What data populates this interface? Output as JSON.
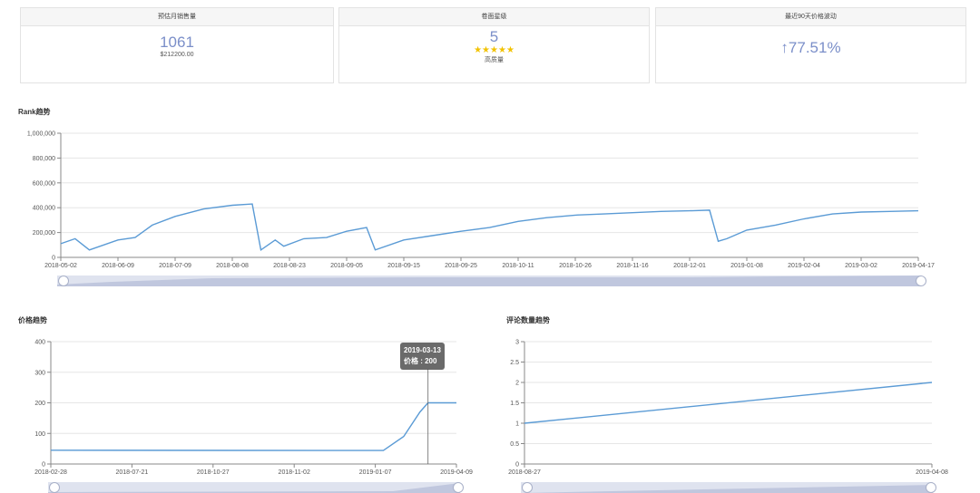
{
  "cards": [
    {
      "head": "预估月销售量",
      "value": "1061",
      "sub": "$212200.00"
    },
    {
      "head": "卷面星级",
      "value": "5",
      "stars": "★★★★★",
      "sub": "高质量"
    },
    {
      "head": "最近90天价格波动",
      "value": "↑77.51%"
    }
  ],
  "sections": {
    "rank": "Rank趋势",
    "price": "价格趋势",
    "reviews": "评论数量趋势"
  },
  "tooltip": {
    "date": "2019-03-13",
    "label": "价格 : 200"
  },
  "colors": {
    "line": "#5b9bd5",
    "accent": "#7b8fc9",
    "star": "#f2c200"
  },
  "chart_data": [
    {
      "type": "line",
      "title": "Rank趋势",
      "ylim": [
        0,
        1000000
      ],
      "y_ticks": [
        "0",
        "200,000",
        "400,000",
        "600,000",
        "800,000",
        "1,000,000"
      ],
      "x_ticks": [
        "2018-05-02",
        "2018-06-09",
        "2018-07-09",
        "2018-08-08",
        "2018-08-23",
        "2018-09-05",
        "2018-09-15",
        "2018-09-25",
        "2018-10-11",
        "2018-10-26",
        "2018-11-16",
        "2018-12-01",
        "2019-01-08",
        "2019-02-04",
        "2019-03-02",
        "2019-04-17"
      ],
      "points": [
        [
          0,
          110000
        ],
        [
          0.5,
          150000
        ],
        [
          1,
          60000
        ],
        [
          2,
          140000
        ],
        [
          2.6,
          160000
        ],
        [
          3.2,
          260000
        ],
        [
          4,
          330000
        ],
        [
          5,
          390000
        ],
        [
          6,
          420000
        ],
        [
          6.7,
          430000
        ],
        [
          7,
          60000
        ],
        [
          7.5,
          140000
        ],
        [
          7.8,
          90000
        ],
        [
          8.5,
          150000
        ],
        [
          9.3,
          160000
        ],
        [
          10,
          210000
        ],
        [
          10.7,
          240000
        ],
        [
          11,
          60000
        ],
        [
          12,
          140000
        ],
        [
          13,
          175000
        ],
        [
          14,
          210000
        ],
        [
          15,
          240000
        ],
        [
          16,
          290000
        ],
        [
          17,
          320000
        ],
        [
          18,
          340000
        ],
        [
          19,
          350000
        ],
        [
          20,
          360000
        ],
        [
          21,
          370000
        ],
        [
          22,
          375000
        ],
        [
          22.7,
          380000
        ],
        [
          23,
          130000
        ],
        [
          23.3,
          150000
        ],
        [
          24,
          220000
        ],
        [
          25,
          260000
        ],
        [
          26,
          310000
        ],
        [
          27,
          350000
        ],
        [
          28,
          365000
        ],
        [
          29,
          370000
        ],
        [
          30,
          375000
        ]
      ],
      "x_max": 30
    },
    {
      "type": "line",
      "title": "价格趋势",
      "ylim": [
        0,
        400
      ],
      "y_ticks": [
        "0",
        "100",
        "200",
        "300",
        "400"
      ],
      "x_ticks": [
        "2018-02-28",
        "2018-07-21",
        "2018-10-27",
        "2018-11-02",
        "2019-01-07",
        "2019-04-09"
      ],
      "points": [
        [
          0,
          45
        ],
        [
          3.5,
          44
        ],
        [
          4.1,
          44
        ],
        [
          4.35,
          90
        ],
        [
          4.55,
          170
        ],
        [
          4.65,
          200
        ],
        [
          5,
          200
        ]
      ],
      "x_max": 5
    },
    {
      "type": "line",
      "title": "评论数量趋势",
      "ylim": [
        0,
        3
      ],
      "y_ticks": [
        "0",
        "0.5",
        "1",
        "1.5",
        "2",
        "2.5",
        "3"
      ],
      "x_ticks": [
        "2018-08-27",
        "2019-04-08"
      ],
      "points": [
        [
          0,
          1
        ],
        [
          1,
          2
        ]
      ],
      "x_max": 1
    }
  ]
}
